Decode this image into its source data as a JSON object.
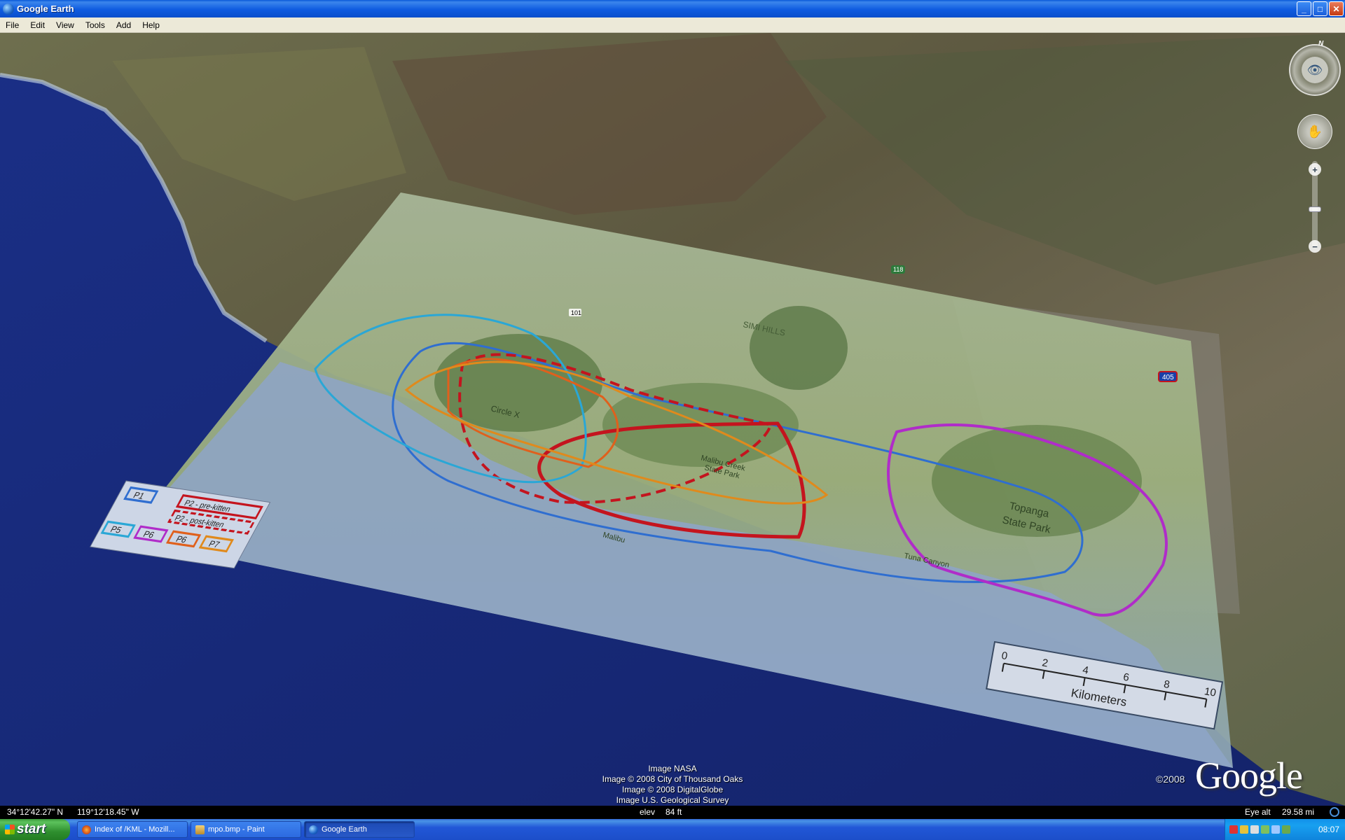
{
  "window": {
    "title": "Google Earth"
  },
  "menu": [
    "File",
    "Edit",
    "View",
    "Tools",
    "Add",
    "Help"
  ],
  "map": {
    "place_labels": {
      "simi_hills": "SIMI HILLS",
      "circle_x": "Circle X",
      "topanga": "Topanga",
      "state_park": "State Park",
      "tuna_canyon": "Tuna Canyon",
      "malibu": "Malibu",
      "malibu_creek": "Malibu Creek",
      "malibu_creek_sp": "State Park",
      "route_101": "101",
      "route_118": "118",
      "route_405": "405"
    },
    "legend": {
      "p1": "P1",
      "p2_pre": "P2 - pre-kitten",
      "p2_post": "P2 - post-kitten",
      "p5": "P5",
      "p6": "P6",
      "p6b": "P6",
      "p7": "P7"
    },
    "scale": {
      "ticks": [
        "0",
        "2",
        "4",
        "6",
        "8",
        "10"
      ],
      "unit": "Kilometers"
    },
    "colors": {
      "p1": "#2f6ed0",
      "p2": "#c4141e",
      "p5": "#2aa7d6",
      "p6": "#b02cc9",
      "p6b": "#e0601c",
      "p7": "#e08a1c"
    }
  },
  "credits": {
    "line1": "Image NASA",
    "line2": "Image © 2008 City of Thousand Oaks",
    "line3": "Image © 2008 DigitalGlobe",
    "line4": "Image U.S. Geological Survey"
  },
  "branding": {
    "copyright": "©2008",
    "logo": "Google"
  },
  "navigation": {
    "north": "N",
    "zoom_in": "+",
    "zoom_out": "−"
  },
  "status": {
    "lat": "34°12'42.27\" N",
    "lon": "119°12'18.45\" W",
    "elev_label": "elev",
    "elev_value": "84 ft",
    "eye_label": "Eye alt",
    "eye_value": "29.58 mi"
  },
  "taskbar": {
    "start": "start",
    "tasks": [
      "Index of /KML - Mozill...",
      "mpo.bmp - Paint",
      "Google Earth"
    ],
    "clock": "08:07"
  }
}
